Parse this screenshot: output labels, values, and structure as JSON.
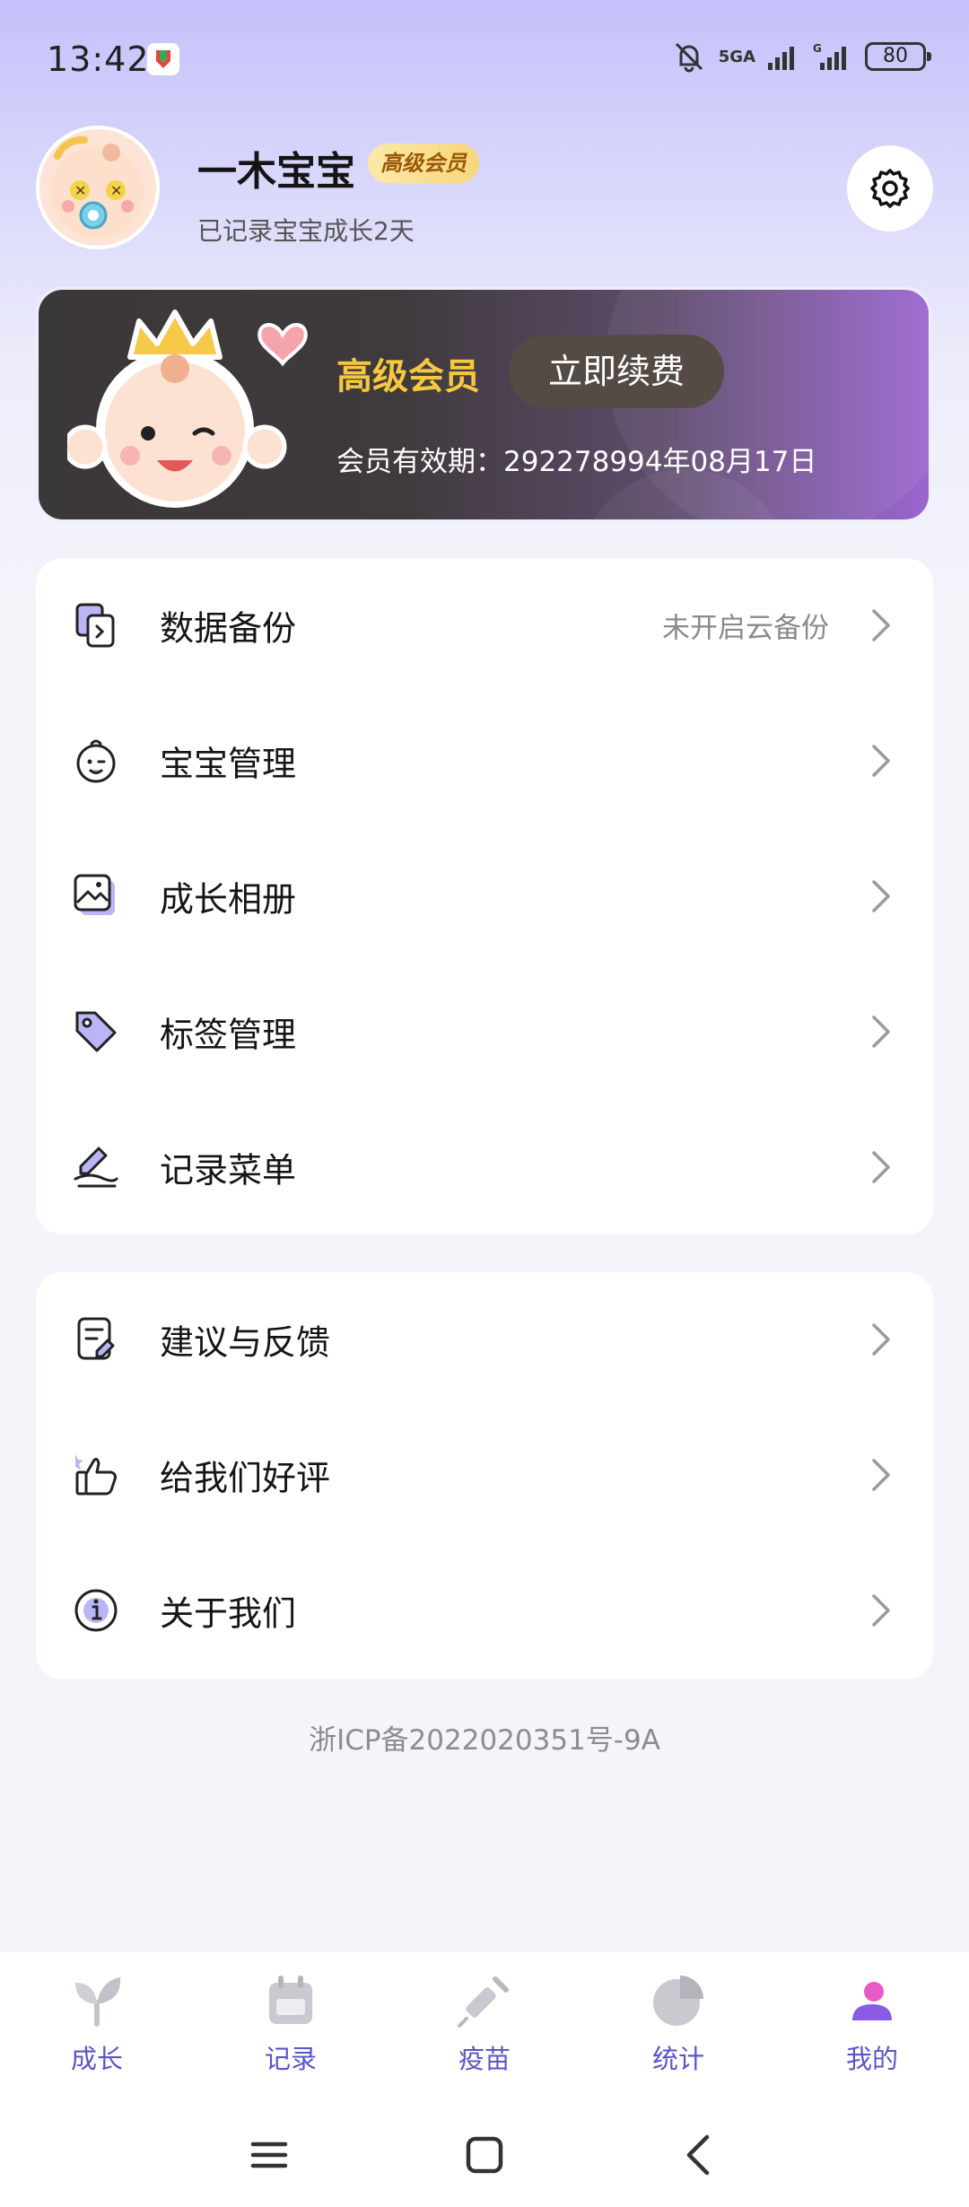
{
  "status": {
    "time": "13:42",
    "network": "5GA",
    "battery": "80"
  },
  "profile": {
    "name": "一木宝宝",
    "badge": "高级会员",
    "subtitle": "已记录宝宝成长2天"
  },
  "vip": {
    "title": "高级会员",
    "renew_label": "立即续费",
    "expire_text": "会员有效期：292278994年08月17日"
  },
  "menu1": [
    {
      "label": "数据备份",
      "value": "未开启云备份",
      "icon": "data-backup-icon"
    },
    {
      "label": "宝宝管理",
      "value": "",
      "icon": "baby-face-icon"
    },
    {
      "label": "成长相册",
      "value": "",
      "icon": "photo-album-icon"
    },
    {
      "label": "标签管理",
      "value": "",
      "icon": "tag-icon"
    },
    {
      "label": "记录菜单",
      "value": "",
      "icon": "pen-menu-icon"
    }
  ],
  "menu2": [
    {
      "label": "建议与反馈",
      "icon": "feedback-icon"
    },
    {
      "label": "给我们好评",
      "icon": "thumbs-up-icon"
    },
    {
      "label": "关于我们",
      "icon": "info-icon"
    }
  ],
  "icp": "浙ICP备2022020351号-9A",
  "nav": [
    {
      "label": "成长",
      "icon": "leaf-icon"
    },
    {
      "label": "记录",
      "icon": "calendar-icon"
    },
    {
      "label": "疫苗",
      "icon": "syringe-icon"
    },
    {
      "label": "统计",
      "icon": "pie-chart-icon"
    },
    {
      "label": "我的",
      "icon": "profile-icon",
      "active": true
    }
  ],
  "colors": {
    "accent": "#5a56c5",
    "gold": "#f6c83f",
    "icon_purple": "#b9b6f5"
  }
}
